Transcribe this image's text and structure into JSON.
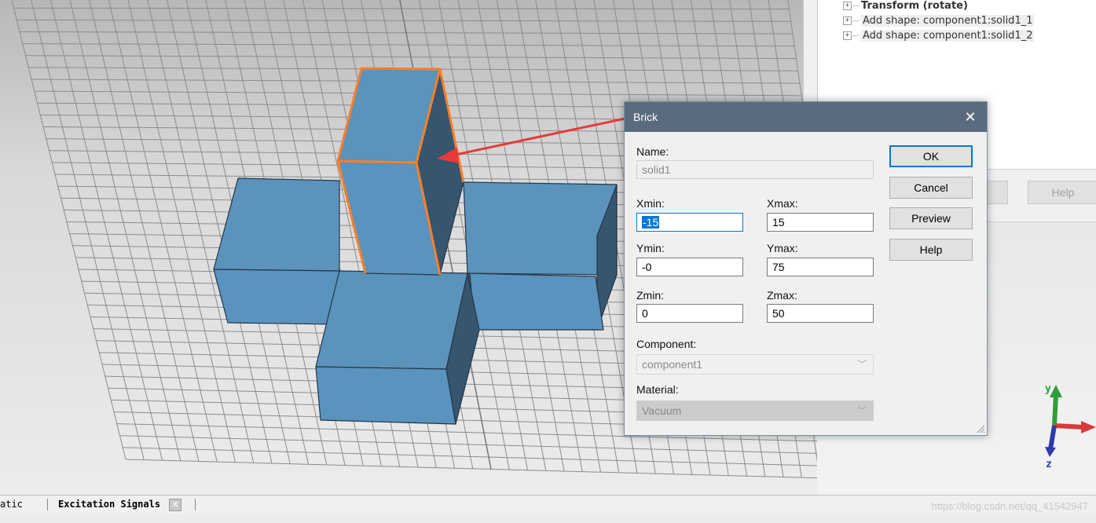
{
  "tree": {
    "items": [
      {
        "label": "Transform (rotate)"
      },
      {
        "label": "Add shape: component1:solid1_1"
      },
      {
        "label": "Add shape: component1:solid1_2"
      }
    ]
  },
  "background_dialog": {
    "help_label": "Help"
  },
  "dialog": {
    "title": "Brick",
    "close_glyph": "✕",
    "name_label": "Name:",
    "name_value": "solid1",
    "xmin_label": "Xmin:",
    "xmin_value": "-15",
    "xmax_label": "Xmax:",
    "xmax_value": "15",
    "ymin_label": "Ymin:",
    "ymin_value": "-0",
    "ymax_label": "Ymax:",
    "ymax_value": "75",
    "zmin_label": "Zmin:",
    "zmin_value": "0",
    "zmax_label": "Zmax:",
    "zmax_value": "50",
    "component_label": "Component:",
    "component_value": "component1",
    "material_label": "Material:",
    "material_value": "Vacuum",
    "ok_label": "OK",
    "cancel_label": "Cancel",
    "preview_label": "Preview",
    "help_label": "Help"
  },
  "tabs": {
    "partial_label": "atic",
    "excitation_label": "Excitation Signals",
    "close_glyph": "✕"
  },
  "axes": {
    "x": "x",
    "y": "y",
    "z": "z"
  },
  "watermark": "https://blog.csdn.net/qq_41542947",
  "colors": {
    "dialog_title_bg": "#5a6b7e",
    "accent": "#0078d7",
    "shape_top": "#5b93bb",
    "shape_side": "#35566e",
    "highlight": "#ff7f2a",
    "arrow": "#e83a3a"
  }
}
